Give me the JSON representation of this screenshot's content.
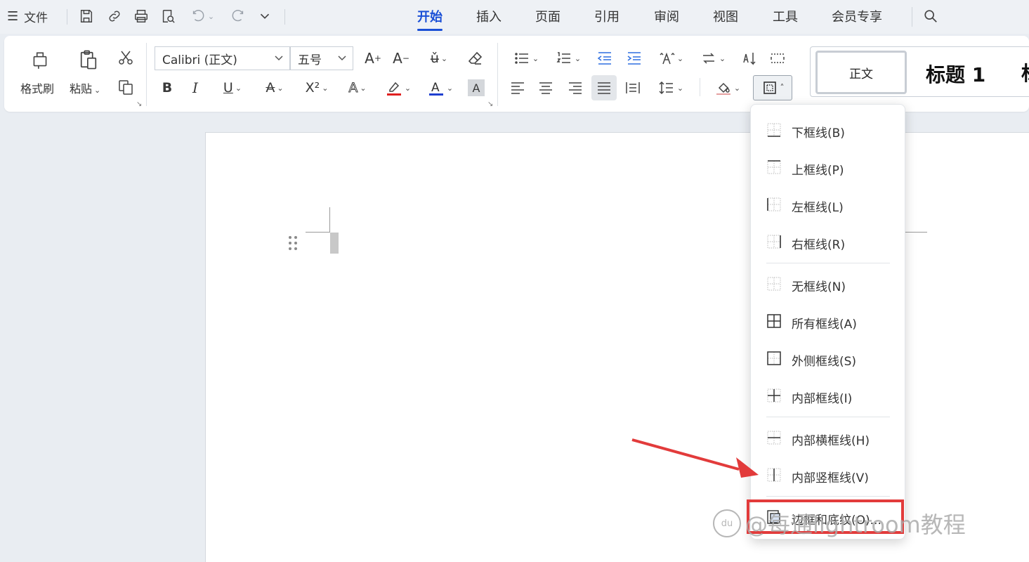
{
  "menu": {
    "file_label": "文件"
  },
  "tabs": [
    "开始",
    "插入",
    "页面",
    "引用",
    "审阅",
    "视图",
    "工具",
    "会员专享"
  ],
  "ribbon": {
    "format_painter": "格式刷",
    "paste": "粘贴",
    "font_name": "Calibri (正文)",
    "font_size": "五号",
    "style_normal": "正文",
    "style_heading": "标题 1",
    "style_more": "标"
  },
  "border_menu": {
    "items": [
      {
        "label": "下框线(B)",
        "icon": "bottom-border-icon"
      },
      {
        "label": "上框线(P)",
        "icon": "top-border-icon"
      },
      {
        "label": "左框线(L)",
        "icon": "left-border-icon"
      },
      {
        "label": "右框线(R)",
        "icon": "right-border-icon"
      },
      {
        "label": "无框线(N)",
        "icon": "no-border-icon"
      },
      {
        "label": "所有框线(A)",
        "icon": "all-borders-icon"
      },
      {
        "label": "外侧框线(S)",
        "icon": "outside-borders-icon"
      },
      {
        "label": "内部框线(I)",
        "icon": "inside-borders-icon"
      },
      {
        "label": "内部横框线(H)",
        "icon": "inside-horizontal-border-icon"
      },
      {
        "label": "内部竖框线(V)",
        "icon": "inside-vertical-border-icon"
      },
      {
        "label": "边框和底纹(O)...",
        "icon": "borders-shading-icon"
      }
    ]
  },
  "watermark": {
    "logo_text": "du",
    "text": "@每通lightroom教程"
  },
  "colors": {
    "accent": "#1a4fd6",
    "highlight_red": "#e23b3b",
    "font_color_red": "#e02020",
    "font_color_blue": "#1f3fd0"
  }
}
